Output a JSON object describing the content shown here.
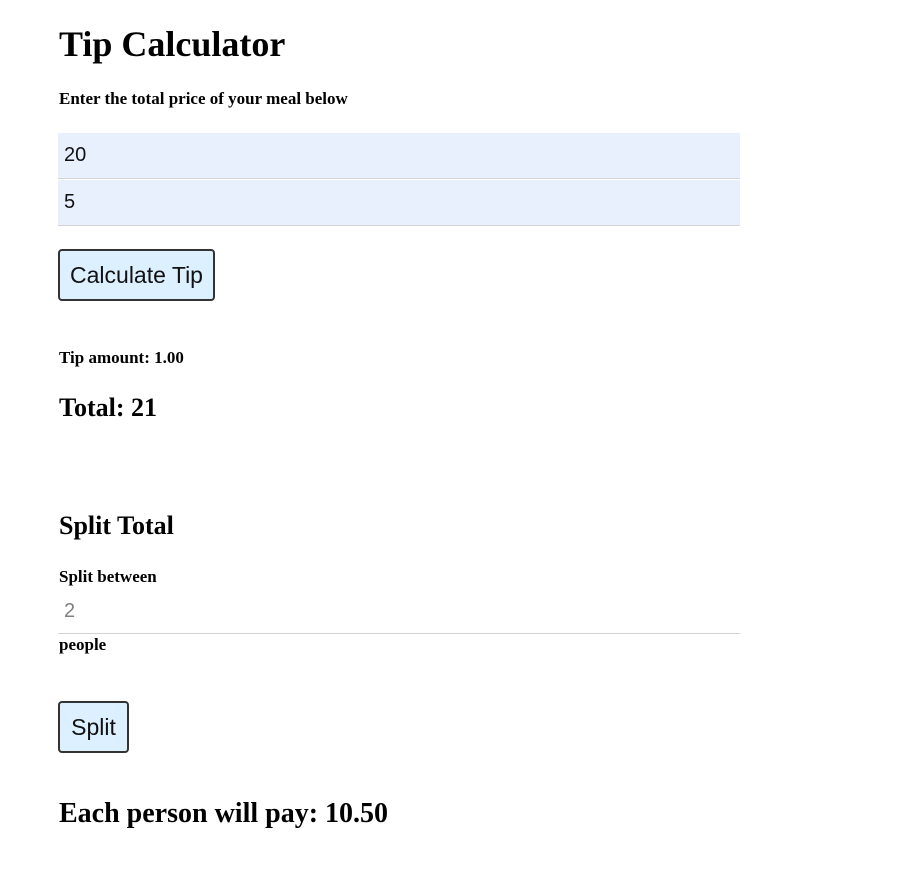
{
  "title": "Tip Calculator",
  "instruction": "Enter the total price of your meal below",
  "inputs": {
    "meal_price": "20",
    "tip_percent": "5"
  },
  "buttons": {
    "calculate": "Calculate Tip",
    "split": "Split"
  },
  "results": {
    "tip_amount": "Tip amount: 1.00",
    "total": "Total: 21"
  },
  "split": {
    "heading": "Split Total",
    "label": "Split between",
    "placeholder": "2",
    "unit_label": "people",
    "result": "Each person will pay: 10.50"
  },
  "colors": {
    "input_background": "#e8f0fe",
    "button_background": "#ddf0ff",
    "button_border": "#333333"
  }
}
